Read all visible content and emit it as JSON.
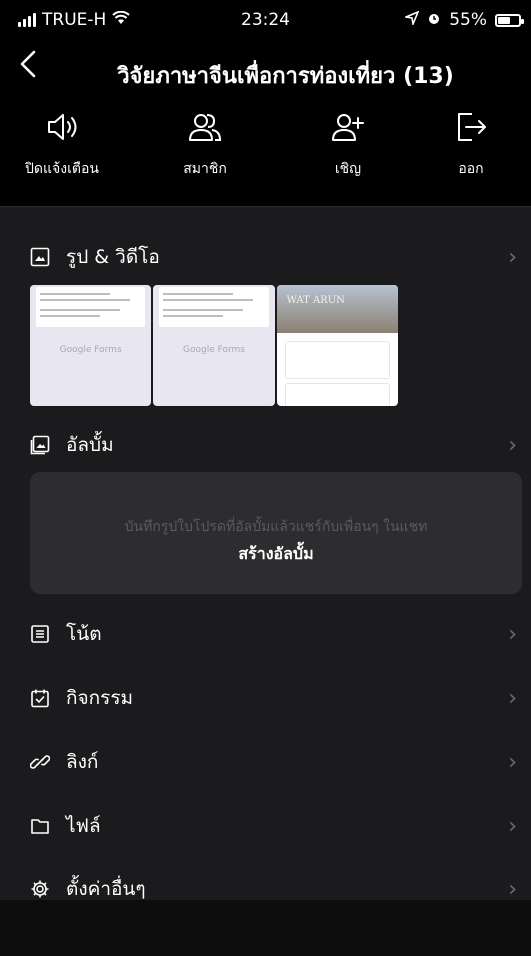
{
  "status_bar": {
    "carrier": "TRUE-H",
    "time": "23:24",
    "battery": "55%"
  },
  "header": {
    "title": "วิจัยภาษาจีนเพื่อการท่องเที่ยว (13)"
  },
  "actions": [
    {
      "label": "ปิดแจ้งเตือน",
      "icon": "speaker-icon"
    },
    {
      "label": "สมาชิก",
      "icon": "members-icon"
    },
    {
      "label": "เชิญ",
      "icon": "invite-icon"
    },
    {
      "label": "ออก",
      "icon": "leave-icon"
    }
  ],
  "sections": {
    "media_label": "รูป & วิดีโอ",
    "album_label": "อัลบั้ม",
    "album_hint": "บันทึกรูปใบโปรดที่อัลบั้มแล้วแชร์กับเพื่อนๆ ในแชท",
    "album_create": "สร้างอัลบั้ม",
    "items": [
      {
        "label": "โน้ต",
        "icon": "note-icon"
      },
      {
        "label": "กิจกรรม",
        "icon": "calendar-icon"
      },
      {
        "label": "ลิงก์",
        "icon": "link-icon"
      },
      {
        "label": "ไฟล์",
        "icon": "folder-icon"
      },
      {
        "label": "ตั้งค่าอื่นๆ",
        "icon": "gear-icon"
      }
    ]
  },
  "thumbnails": {
    "form_footer": "Google Forms",
    "photo_caption": "WAT ARUN"
  }
}
